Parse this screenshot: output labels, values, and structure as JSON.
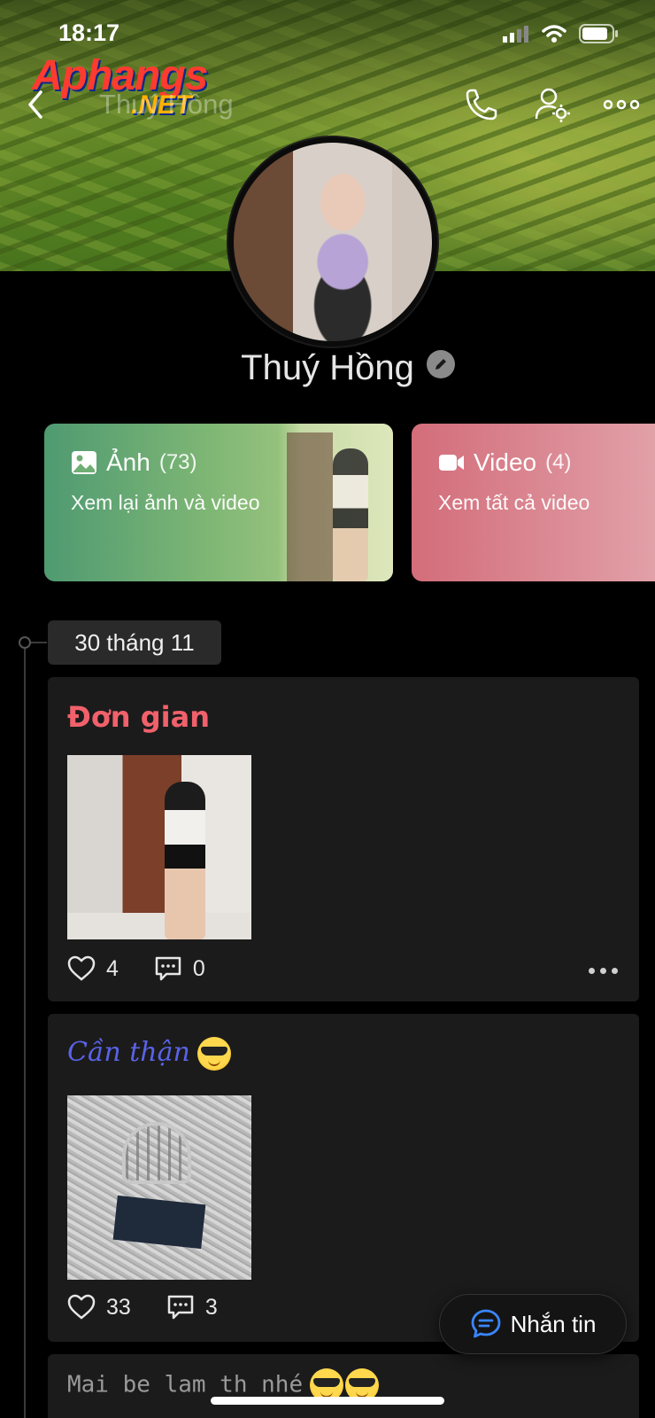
{
  "status_bar": {
    "time": "18:17"
  },
  "watermark": {
    "main": "Aphangs",
    "suffix": ".NET"
  },
  "header": {
    "title": "Thuý Hồng"
  },
  "profile": {
    "name": "Thuý Hồng"
  },
  "media_cards": [
    {
      "label": "Ảnh",
      "count": "(73)",
      "subtitle": "Xem lại ảnh và video"
    },
    {
      "label": "Video",
      "count": "(4)",
      "subtitle": "Xem tất cả video"
    }
  ],
  "timeline": {
    "date": "30 tháng 11"
  },
  "posts": [
    {
      "title": "Đơn gian",
      "likes": "4",
      "comments": "0"
    },
    {
      "title": "Cần thận",
      "likes": "33",
      "comments": "3"
    },
    {
      "title": "Mai be lam th nhé"
    }
  ],
  "message_button": {
    "label": "Nhắn tin"
  },
  "colors": {
    "accent_blue": "#3a86ff",
    "post_title_red": "#f0616b",
    "post_title_blue": "#5a63e8"
  }
}
